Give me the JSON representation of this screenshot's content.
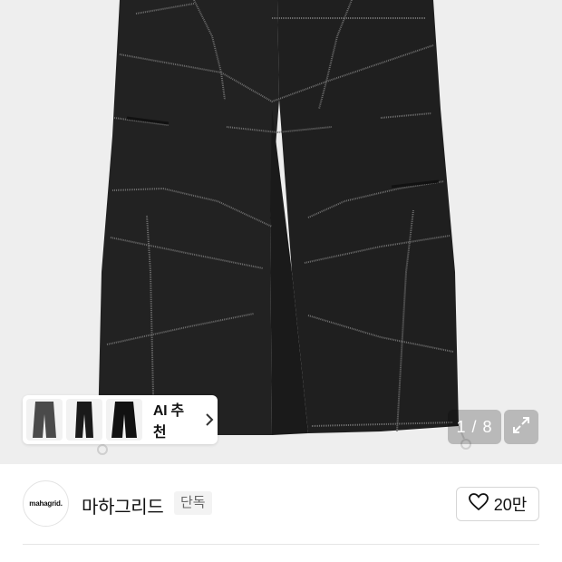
{
  "gallery": {
    "counter": "1 / 8",
    "current_page": 1,
    "total_pages": 8
  },
  "ai_recommend": {
    "label": "AI 추천",
    "thumbnail_count": 3
  },
  "brand": {
    "logo_text": "mahagrid.",
    "name": "마하그리드",
    "badge": "단독"
  },
  "like": {
    "count": "20만"
  },
  "icons": {
    "chevron": "chevron-right-icon",
    "expand": "expand-icon",
    "heart": "heart-outline-icon"
  },
  "colors": {
    "hero_background": "#eeeeee",
    "garment": "#1f1f1f",
    "stitch": "#6e6e6e"
  }
}
